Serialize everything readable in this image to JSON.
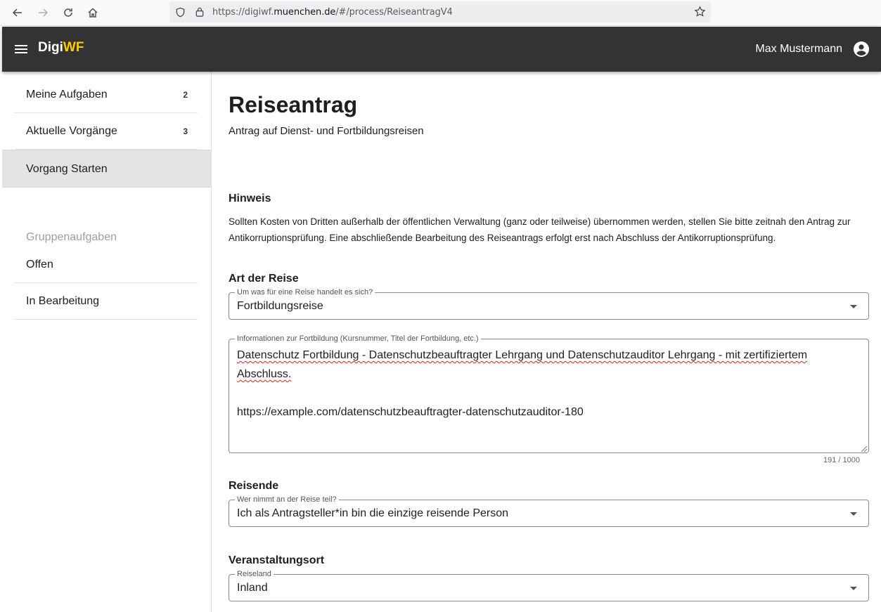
{
  "browser": {
    "url_prefix": "https://digiwf.",
    "url_domain": "muenchen.de",
    "url_suffix": "/#/process/ReiseantragV4"
  },
  "appbar": {
    "brand_digi": "Digi",
    "brand_wf": "WF",
    "username": "Max Mustermann",
    "brand_accent_color": "#ffcc00",
    "bar_color": "#333333"
  },
  "sidebar": {
    "items": [
      {
        "label": "Meine Aufgaben",
        "count": "2"
      },
      {
        "label": "Aktuelle Vorgänge",
        "count": "3"
      },
      {
        "label": "Vorgang Starten"
      }
    ],
    "group_header": "Gruppenaufgaben",
    "group_items": [
      {
        "label": "Offen"
      },
      {
        "label": "In Bearbeitung"
      }
    ]
  },
  "main": {
    "title": "Reiseantrag",
    "subtitle": "Antrag auf Dienst- und Fortbildungsreisen",
    "hint": {
      "heading": "Hinweis",
      "text": "Sollten Kosten von Dritten außerhalb der öffentlichen Verwaltung (ganz oder teilweise) übernommen werden, stellen Sie bitte zeitnah den Antrag zur Antikorruptionsprüfung. Eine abschließende Bearbeitung des Reiseantrags erfolgt erst nach Abschluss der Antikorruptionsprüfung."
    },
    "art": {
      "heading": "Art der Reise",
      "select_label": "Um was für eine Reise handelt es sich?",
      "select_value": "Fortbildungsreise",
      "textarea_label": "Informationen zur Fortbildung (Kursnummer, Titel der Fortbildung, etc.)",
      "textarea_line1": "Datenschutz Fortbildung -  Datenschutzbeauftragter Lehrgang und Datenschutzauditor Lehrgang - mit zertifiziertem",
      "textarea_line2": "Abschluss.",
      "textarea_line3": "https://example.com/datenschutzbeauftragter-datenschutzauditor-180",
      "counter": "191 / 1000"
    },
    "reisende": {
      "heading": "Reisende",
      "select_label": "Wer nimmt an der Reise teil?",
      "select_value": "Ich als Antragsteller*in bin die einzige reisende Person"
    },
    "ort": {
      "heading": "Veranstaltungsort",
      "select_label": "Reiseland",
      "select_value": "Inland"
    }
  }
}
